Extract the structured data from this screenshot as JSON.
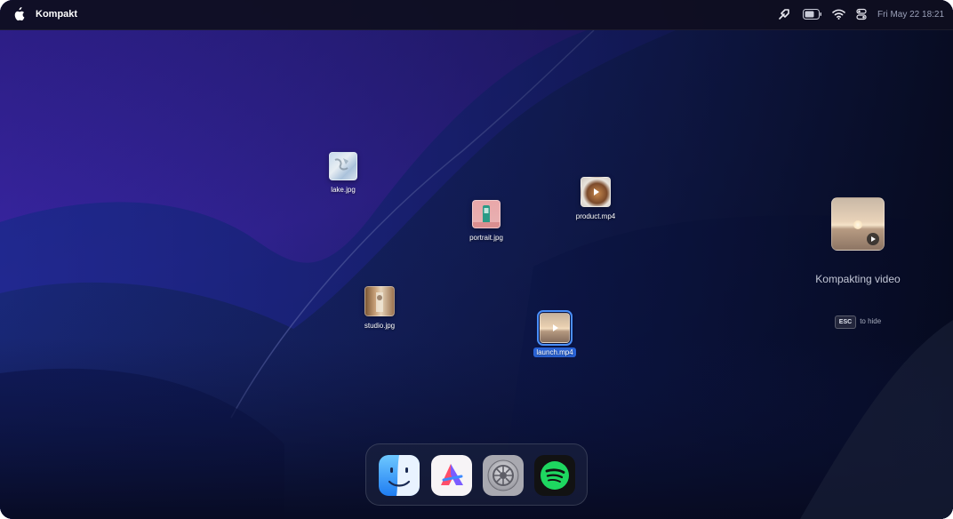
{
  "menubar": {
    "app_name": "Kompakt",
    "clock": "Fri May 22 18:21",
    "icons": [
      "apple-icon",
      "kompakt-menubar-icon",
      "battery-icon",
      "wifi-icon",
      "control-center-icon"
    ]
  },
  "desktop": {
    "files": [
      {
        "name": "lake.jpg",
        "kind": "image"
      },
      {
        "name": "portrait.jpg",
        "kind": "image"
      },
      {
        "name": "product.mp4",
        "kind": "video"
      },
      {
        "name": "studio.jpg",
        "kind": "image"
      },
      {
        "name": "launch.mp4",
        "kind": "video",
        "selected": true
      }
    ]
  },
  "panel": {
    "status": "Kompakting video",
    "esc_key": "ESC",
    "hint": "to hide"
  },
  "dock": {
    "apps": [
      "finder-icon",
      "affinity-icon",
      "system-settings-icon",
      "spotify-icon"
    ]
  },
  "colors": {
    "selection": "#2a64d8",
    "menubar": "#0e0e1e",
    "spotify": "#1ed760"
  }
}
